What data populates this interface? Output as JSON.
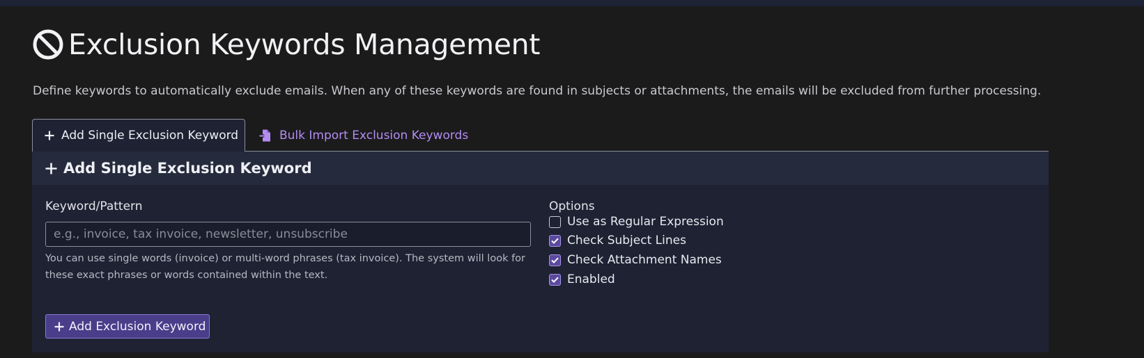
{
  "page": {
    "title": "Exclusion Keywords Management",
    "title_icon": "ban-icon",
    "description": "Define keywords to automatically exclude emails. When any of these keywords are found in subjects or attachments, the emails will be excluded from further processing."
  },
  "tabs": [
    {
      "label": "Add Single Exclusion Keyword",
      "icon": "plus-icon",
      "active": true
    },
    {
      "label": "Bulk Import Exclusion Keywords",
      "icon": "file-import-icon",
      "active": false
    }
  ],
  "panel": {
    "header": "Add Single Exclusion Keyword",
    "keyword_label": "Keyword/Pattern",
    "keyword_value": "",
    "keyword_placeholder": "e.g., invoice, tax invoice, newsletter, unsubscribe",
    "help_text": "You can use single words (invoice) or multi-word phrases (tax invoice). The system will look for these exact phrases or words contained within the text.",
    "options_label": "Options",
    "options": [
      {
        "label": "Use as Regular Expression",
        "checked": false
      },
      {
        "label": "Check Subject Lines",
        "checked": true
      },
      {
        "label": "Check Attachment Names",
        "checked": true
      },
      {
        "label": "Enabled",
        "checked": true
      }
    ],
    "submit_label": "Add Exclusion Keyword"
  },
  "colors": {
    "background": "#1b1b1c",
    "panel": "#1e2233",
    "accent": "#5b4a9e",
    "link": "#b48cf2"
  }
}
